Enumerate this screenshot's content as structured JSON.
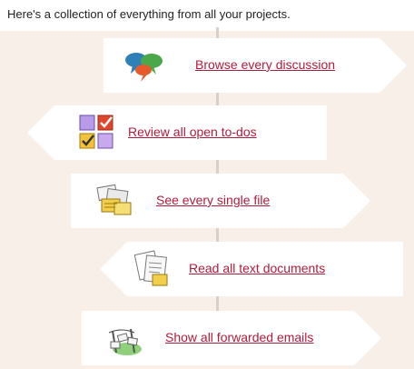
{
  "header": {
    "title": "Here's a collection of everything from all your projects."
  },
  "items": [
    {
      "label": "Browse every discussion",
      "icon": "speech-bubbles-icon"
    },
    {
      "label": "Review all open to-dos",
      "icon": "todo-checkboxes-icon"
    },
    {
      "label": "See every single file",
      "icon": "file-stack-icon"
    },
    {
      "label": "Read all text documents",
      "icon": "text-documents-icon"
    },
    {
      "label": "Show all forwarded emails",
      "icon": "forwarded-emails-icon"
    }
  ],
  "colors": {
    "link": "#b01d3c",
    "background": "#f8efe8",
    "card": "#ffffff"
  }
}
